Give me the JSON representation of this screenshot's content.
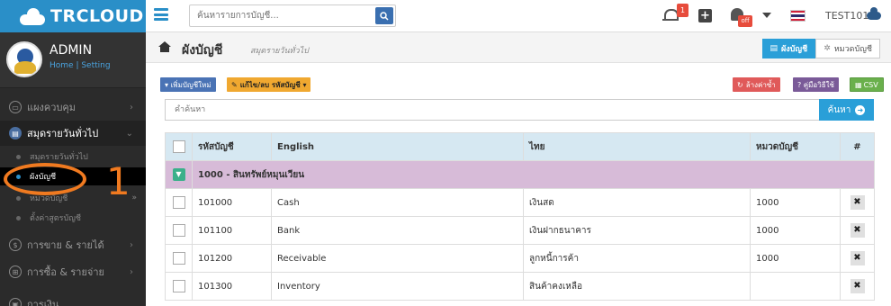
{
  "brand": {
    "name": "TRCLOUD"
  },
  "top": {
    "search_placeholder": "ค้นหารายการบัญชี...",
    "notification_count": "1",
    "off_badge": "off",
    "user_label": "TEST101"
  },
  "profile": {
    "name": "ADMIN",
    "home_link": "Home",
    "separator": " | ",
    "setting_link": "Setting"
  },
  "nav": {
    "dashboard": "แผงควบคุม",
    "journal": "สมุดรายวันทั่วไป",
    "journal_sub": "สมุดรายวันทั่วไป",
    "chart_of_accounts": "ผังบัญชี",
    "account_type": "หมวดบัญชี",
    "account_formula": "ตั้งค่าสูตรบัญชี",
    "sales": "การขาย & รายได้",
    "purchase": "การซื้อ & รายจ่าย",
    "finance": "การเงิน"
  },
  "annotation": {
    "number": "1"
  },
  "page": {
    "title": "ผังบัญชี",
    "subtitle": "สมุดรายวันทั่วไป",
    "tab_chart": "ผังบัญชี",
    "tab_category": "หมวดบัญชี"
  },
  "toolbar": {
    "add_account": "▾ เพิ่มบัญชีใหม่",
    "edit_account": "แก้ไข/ลบ รหัสบัญชี ▾",
    "clear": "ล้างค่าซ้ำ",
    "guide": "? คู่มือวิธีใช้",
    "csv": "CSV"
  },
  "search": {
    "placeholder": "คำค้นหา",
    "button": "ค้นหา"
  },
  "table": {
    "headers": {
      "code": "รหัสบัญชี",
      "english": "English",
      "thai": "ไทย",
      "category": "หมวดบัญชี",
      "hash": "#"
    },
    "group": "1000 - สินทรัพย์หมุนเวียน",
    "rows": [
      {
        "code": "101000",
        "english": "Cash",
        "thai": "เงินสด",
        "category": "1000"
      },
      {
        "code": "101100",
        "english": "Bank",
        "thai": "เงินฝากธนาคาร",
        "category": "1000"
      },
      {
        "code": "101200",
        "english": "Receivable",
        "thai": "ลูกหนี้การค้า",
        "category": "1000"
      },
      {
        "code": "101300",
        "english": "Inventory",
        "thai": "สินค้าคงเหลือ",
        "category": ""
      }
    ]
  }
}
